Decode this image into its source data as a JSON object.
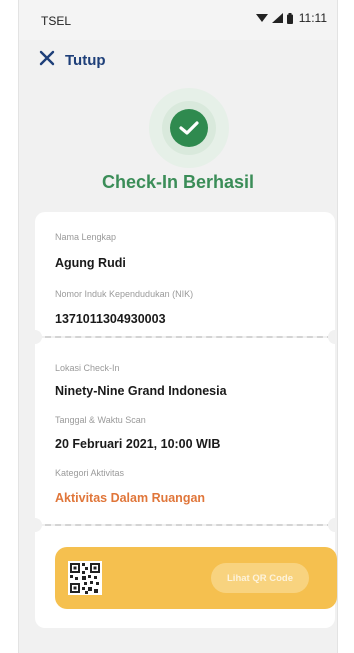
{
  "status_bar": {
    "carrier": "TSEL",
    "time": "11:11"
  },
  "header": {
    "close_label": "Tutup"
  },
  "result": {
    "title": "Check-In Berhasil",
    "icon": "check-icon",
    "accent_color": "#2f8a4f"
  },
  "identity": {
    "name_label": "Nama Lengkap",
    "name_value": "Agung Rudi",
    "nik_label": "Nomor Induk Kependudukan (NIK)",
    "nik_value": "1371011304930003"
  },
  "checkin": {
    "location_label": "Lokasi Check-In",
    "location_value": "Ninety-Nine Grand Indonesia",
    "datetime_label": "Tanggal & Waktu Scan",
    "datetime_value": "20 Februari 2021, 10:00 WIB",
    "category_label": "Kategori Aktivitas",
    "category_value": "Aktivitas Dalam Ruangan",
    "category_color": "#e0763a"
  },
  "qr": {
    "icon": "qr-code-icon",
    "button_label": "Lihat QR Code",
    "banner_color": "#f5c04f"
  }
}
